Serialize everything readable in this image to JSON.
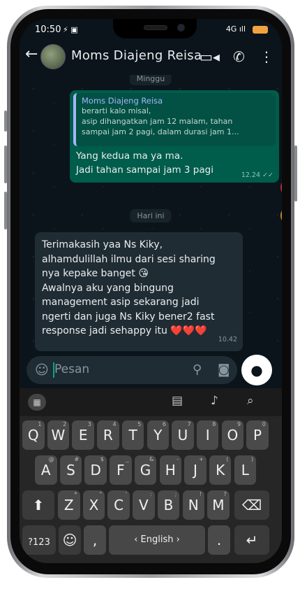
{
  "status": {
    "time": "10:50",
    "time_extra": "⚡ ▣",
    "signal": "4G ıll"
  },
  "header": {
    "back_icon": "arrow-left-icon",
    "contact_name": "Moms Diajeng Reisa",
    "video_icon": "video-icon",
    "call_icon": "phone-icon",
    "menu_icon": "more-vert-icon"
  },
  "chat": {
    "top_day": "Minggu",
    "outgoing": {
      "quote_name": "Moms Diajeng Reisa",
      "quote_lines": [
        "berarti kalo misal,",
        "asip dihangatkan jam 12 malam, tahan",
        "sampai jam 2 pagi, dalam durasi jam 1..."
      ],
      "lines": [
        "Yang kedua ma ya ma.",
        "Jadi tahan sampai jam 3 pagi"
      ],
      "time": "12.24",
      "ticks": "✓✓"
    },
    "day_today": "Hari ini",
    "incoming": {
      "lines": [
        "Terimakasih yaa Ns Kiky,",
        "alhamdulillah ilmu dari sesi sharing",
        "nya kepake banget 😘",
        "Awalnya aku yang bingung",
        "management asip sekarang jadi",
        "ngerti dan juga Ns Kiky bener2 fast",
        "response jadi sehappy itu ❤️❤️❤️"
      ],
      "time": "10.42"
    }
  },
  "composer": {
    "placeholder": "Pesan",
    "emoji_icon": "sticker-icon",
    "attach_icon": "paperclip-icon",
    "camera_icon": "camera-icon",
    "mic_icon": "mic-icon"
  },
  "keyboard": {
    "toolbar": [
      "apps-icon",
      "clipboard-icon",
      "voice-icon",
      "search-icon"
    ],
    "row1": [
      [
        "Q",
        "1"
      ],
      [
        "W",
        "2"
      ],
      [
        "E",
        "3"
      ],
      [
        "R",
        "4"
      ],
      [
        "T",
        "5"
      ],
      [
        "Y",
        "6"
      ],
      [
        "U",
        "7"
      ],
      [
        "I",
        "8"
      ],
      [
        "O",
        "9"
      ],
      [
        "P",
        "0"
      ]
    ],
    "row2": [
      [
        "A",
        "@"
      ],
      [
        "S",
        "#"
      ],
      [
        "D",
        "$"
      ],
      [
        "F",
        "_"
      ],
      [
        "G",
        "&"
      ],
      [
        "H",
        "-"
      ],
      [
        "J",
        "+"
      ],
      [
        "K",
        "("
      ],
      [
        "L",
        ")"
      ]
    ],
    "row3": [
      [
        "Z",
        "*"
      ],
      [
        "X",
        "\""
      ],
      [
        "C",
        "'"
      ],
      [
        "V",
        ":"
      ],
      [
        "B",
        ";"
      ],
      [
        "N",
        "!"
      ],
      [
        "M",
        "?"
      ]
    ],
    "shift": "⬆",
    "backspace": "⌫",
    "sym": "?123",
    "emoji": "☺",
    "comma": ",",
    "space": "‹ English ›",
    "period": ".",
    "enter": "↵"
  }
}
